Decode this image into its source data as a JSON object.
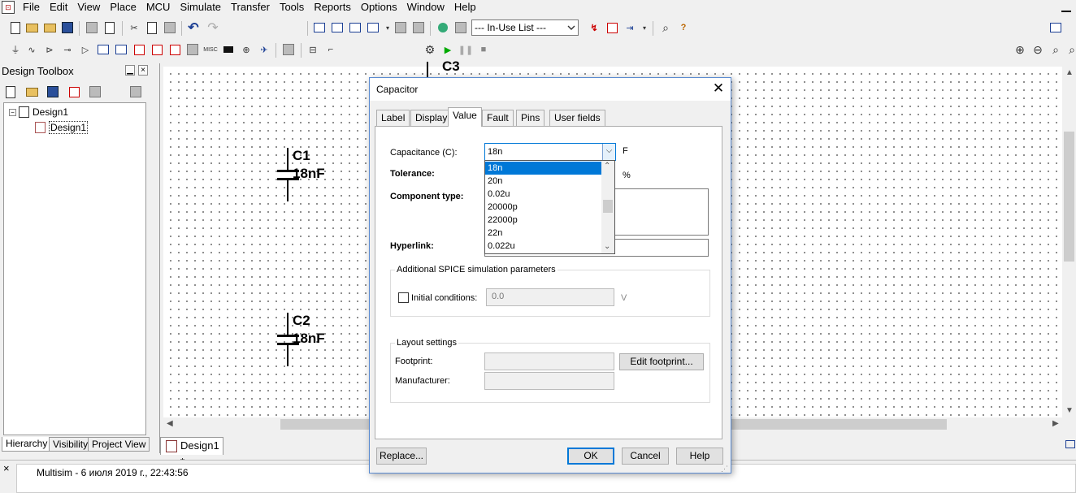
{
  "menu": [
    "File",
    "Edit",
    "View",
    "Place",
    "MCU",
    "Simulate",
    "Transfer",
    "Tools",
    "Reports",
    "Options",
    "Window",
    "Help"
  ],
  "toolbar": {
    "inuse_list": "--- In-Use List ---"
  },
  "toolbox": {
    "title": "Design Toolbox",
    "tree": {
      "root": "Design1",
      "child": "Design1"
    },
    "tabs": [
      "Hierarchy",
      "Visibility",
      "Project View"
    ]
  },
  "canvas": {
    "components": [
      {
        "ref": "C1",
        "value": "18nF"
      },
      {
        "ref": "C2",
        "value": "18nF"
      }
    ],
    "partial_ref": "C3"
  },
  "doc_tab": "Design1 *",
  "status": {
    "close": "×",
    "text": "Multisim  -  6 июля 2019 г., 22:43:56"
  },
  "dialog": {
    "title": "Capacitor",
    "tabs": [
      "Label",
      "Display",
      "Value",
      "Fault",
      "Pins",
      "User fields"
    ],
    "active_tab": "Value",
    "fields": {
      "capacitance_label": "Capacitance (C):",
      "capacitance_value": "18n",
      "capacitance_unit": "F",
      "tolerance_label": "Tolerance:",
      "tolerance_unit": "%",
      "component_type_label": "Component type:",
      "hyperlink_label": "Hyperlink:"
    },
    "dropdown_options": [
      "18n",
      "20n",
      "0.02u",
      "20000p",
      "22000p",
      "22n",
      "0.022u"
    ],
    "dropdown_selected": "18n",
    "spice": {
      "group_title": "Additional SPICE simulation parameters",
      "initial_conditions_label": "Initial conditions:",
      "initial_conditions_value": "0.0",
      "initial_conditions_unit": "V"
    },
    "layout": {
      "group_title": "Layout settings",
      "footprint_label": "Footprint:",
      "manufacturer_label": "Manufacturer:",
      "edit_footprint_button": "Edit footprint..."
    },
    "buttons": {
      "replace": "Replace...",
      "ok": "OK",
      "cancel": "Cancel",
      "help": "Help"
    }
  }
}
